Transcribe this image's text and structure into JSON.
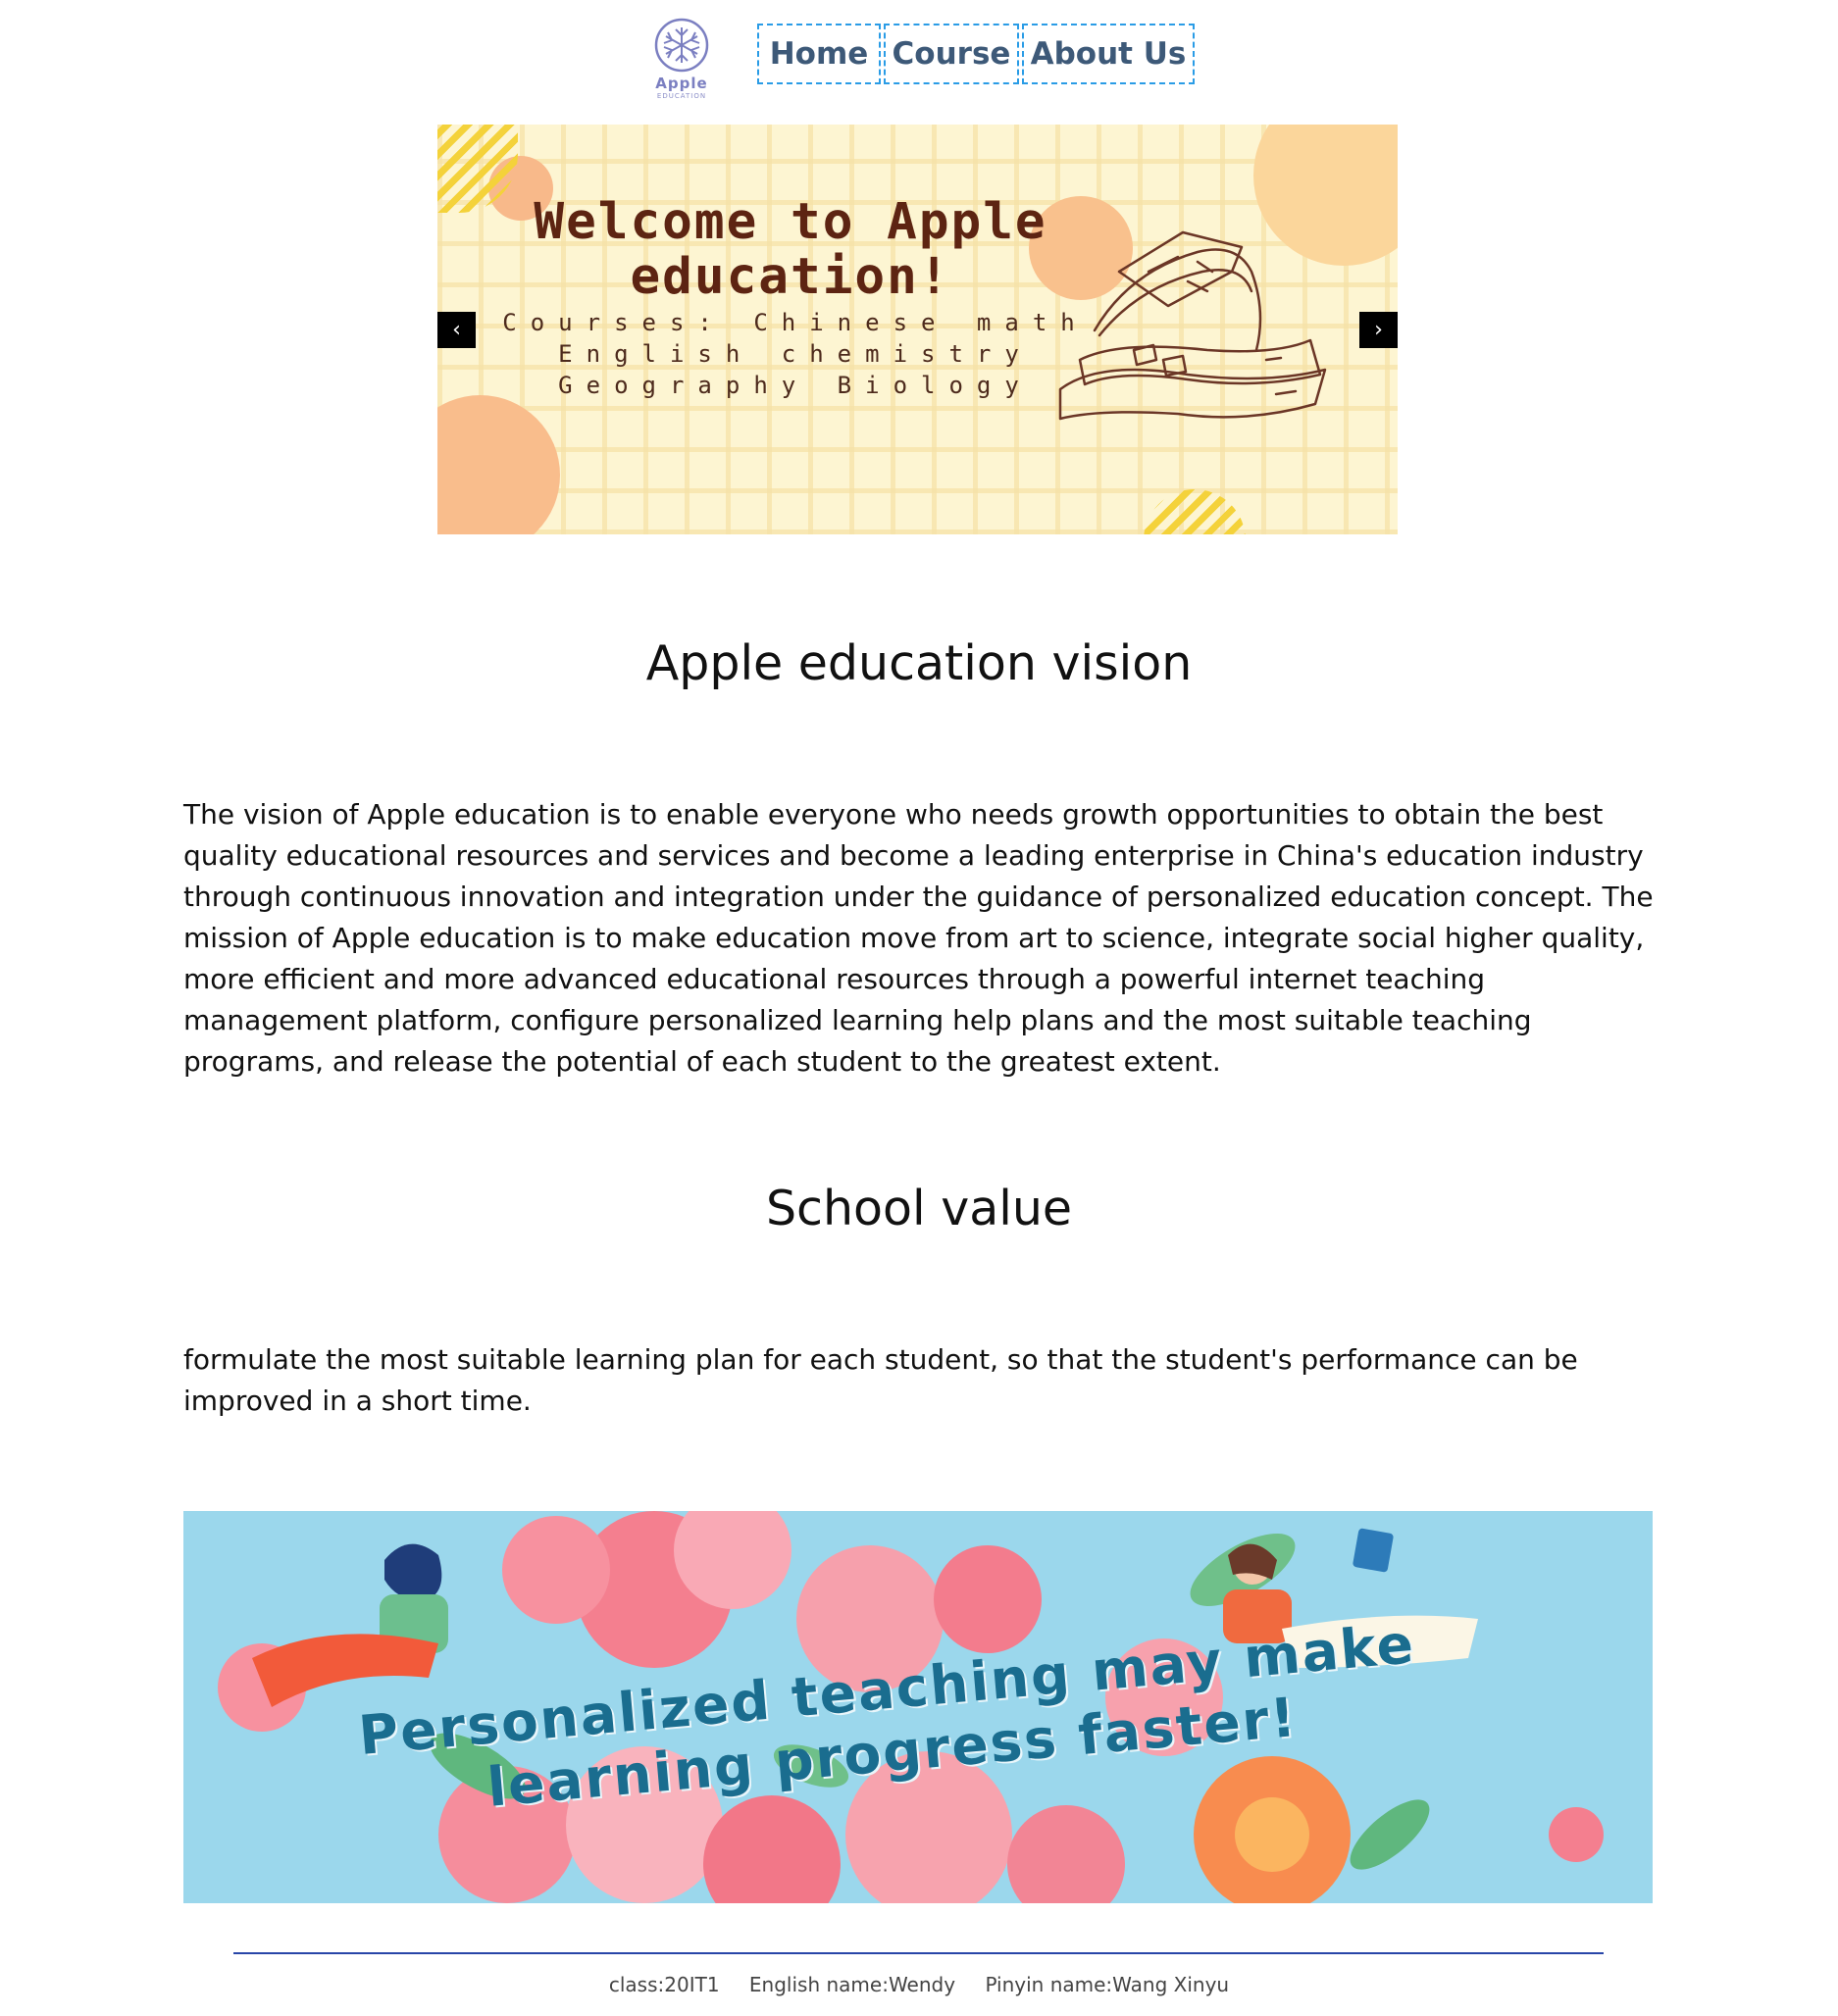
{
  "header": {
    "logo_text": "Apple",
    "logo_subtext": "EDUCATION",
    "nav": [
      {
        "label": "Home"
      },
      {
        "label": "Course"
      },
      {
        "label": "About Us"
      }
    ]
  },
  "carousel": {
    "title": "Welcome to Apple education!",
    "subtitle_lines": [
      "Courses: Chinese math",
      "English chemistry",
      "Geography Biology"
    ],
    "prev_label": "‹",
    "next_label": "›"
  },
  "vision": {
    "heading": "Apple education vision",
    "body": "The vision of Apple education is to enable everyone who needs growth opportunities to obtain the best quality educational resources and services and become a leading enterprise in China's education industry through continuous innovation and integration under the guidance of personalized education concept. The mission of Apple education is to make education move from art to science, integrate social higher quality, more efficient and more advanced educational resources through a powerful internet teaching management platform, configure personalized learning help plans and the most suitable teaching programs, and release the potential of each student to the greatest extent."
  },
  "value": {
    "heading": "School value",
    "body": "formulate the most suitable learning plan for each student, so that the student's performance can be improved in a short time."
  },
  "banner": {
    "text": "Personalized teaching may make learning progress faster!"
  },
  "footer": {
    "class": "class:20IT1",
    "english_name": "English name:Wendy",
    "pinyin_name": "Pinyin name:Wang Xinyu"
  },
  "colors": {
    "nav_border": "#2a9ce6",
    "nav_text": "#3d5978",
    "carousel_bg": "#fdf5d2",
    "banner_bg": "#9bd7ec",
    "footer_rule": "#2846a8"
  }
}
